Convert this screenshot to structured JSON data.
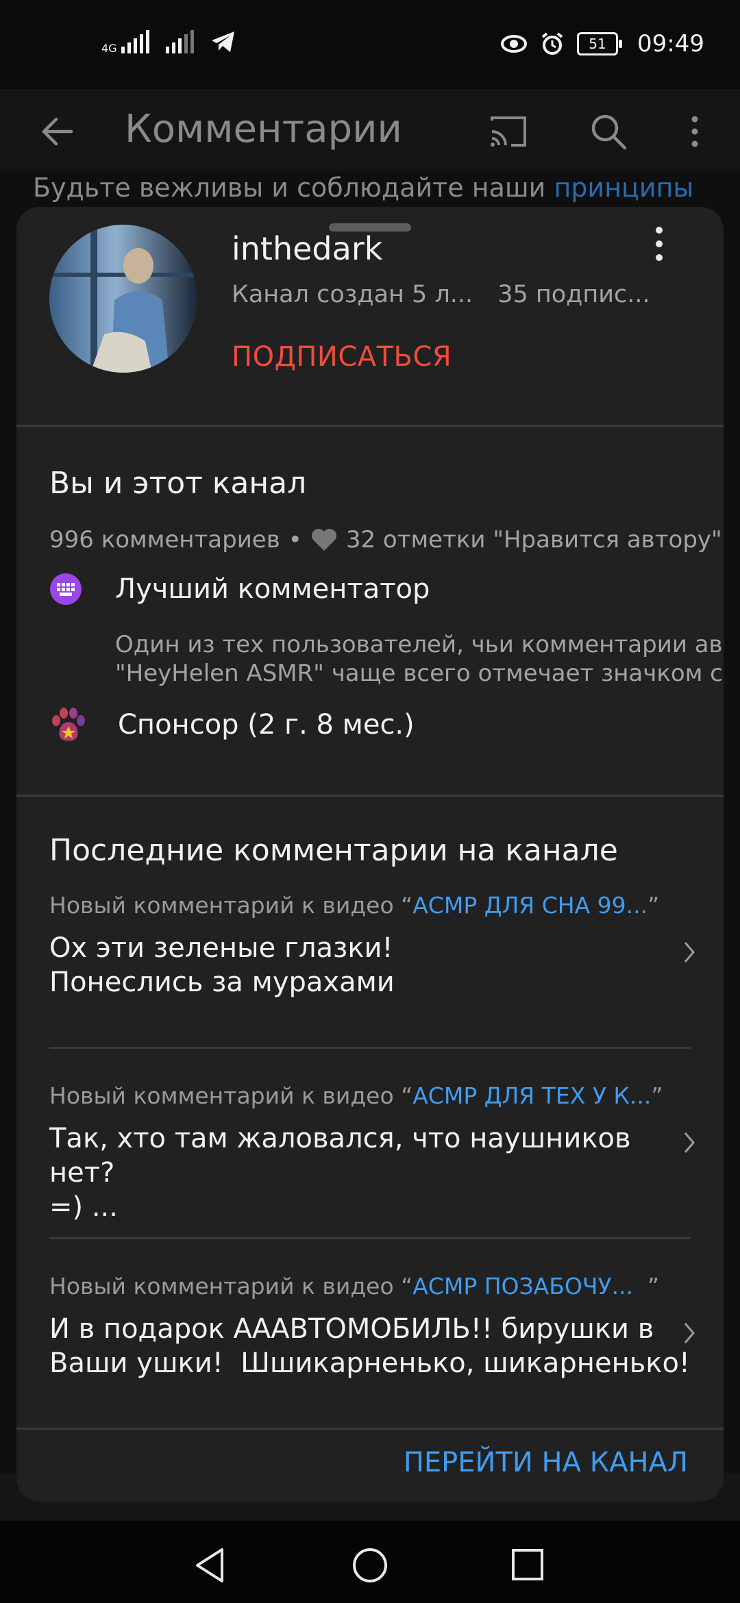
{
  "status_bar": {
    "network": "4G",
    "battery": "51",
    "time": "09:49"
  },
  "app_bar": {
    "title": "Комментарии"
  },
  "guidelines": {
    "prefix": "Будьте вежливы и соблюдайте наши ",
    "link": "принципы"
  },
  "channel": {
    "name": "inthedark",
    "created": "Канал создан 5 л...",
    "subscribers": "35 подпис...",
    "subscribe_label": "ПОДПИСАТЬСЯ"
  },
  "relationship": {
    "title": "Вы и этот канал",
    "comments_count": "996 комментариев",
    "separator": "•",
    "hearts": "32 отметки \"Нравится автору\"",
    "badge_label": "Лучший комментатор",
    "badge_desc_line1": "Один из тех пользователей, чьи комментарии автор",
    "badge_desc_line2": "\"HeyHelen ASMR\" чаще всего отмечает значком се...",
    "sponsor_label": "Спонсор (2 г. 8 мес.)"
  },
  "recent": {
    "title": "Последние комментарии на канале",
    "items": [
      {
        "prefix": "Новый комментарий к видео “",
        "video": "АСМР ДЛЯ СНА 99...",
        "suffix": "”",
        "line1": "Ох эти зеленые глазки!",
        "line2": "Понеслись за мурахами"
      },
      {
        "prefix": "Новый комментарий к видео “",
        "video": "АСМР ДЛЯ ТЕХ У К...",
        "suffix": "”",
        "line1": "Так, хто там жаловался, что наушников нет?",
        "line2": "=) ..."
      },
      {
        "prefix": "Новый комментарий к видео “",
        "video": "АСМР ПОЗАБОЧУ...",
        "suffix": "  ”",
        "line1": "И в подарок АААВТОМОБИЛЬ!! бирушки в",
        "line2": "Ваши ушки!  Шшикарненько, шикарненько!"
      }
    ]
  },
  "footer": {
    "goto_channel": "ПЕРЕЙТИ НА КАНАЛ"
  },
  "colors": {
    "accent_blue": "#3f9cf0",
    "subscribe_red": "#f14c3c",
    "sheet_bg": "#212121"
  }
}
